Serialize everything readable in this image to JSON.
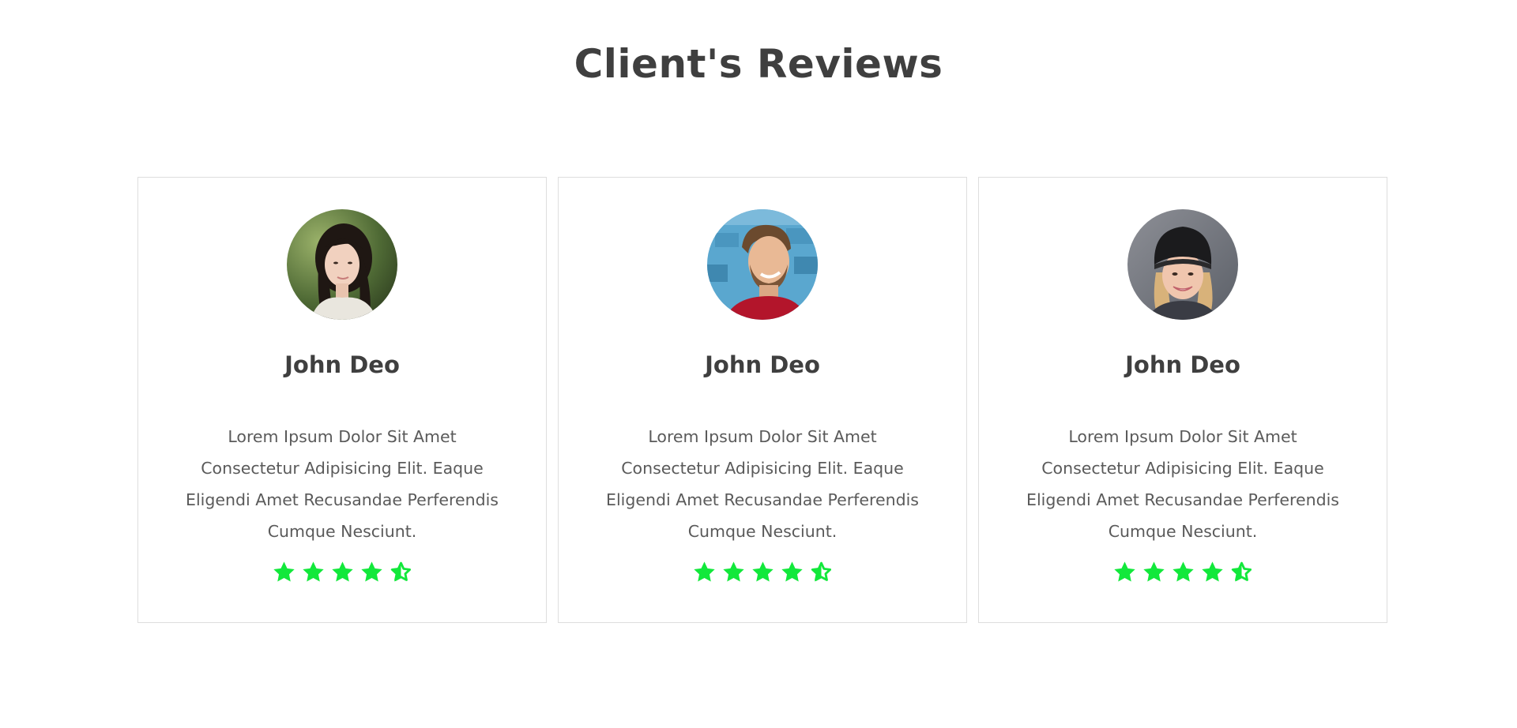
{
  "section": {
    "title": "Client's Reviews"
  },
  "colors": {
    "star": "#12e83b",
    "border": "#dedede",
    "heading": "#3f3f3f"
  },
  "reviews": [
    {
      "name": "John Deo",
      "text": "Lorem Ipsum Dolor Sit Amet Consectetur Adipisicing Elit. Eaque Eligendi Amet Recusandae Perferendis Cumque Nesciunt.",
      "rating": 4.5,
      "avatar": "woman-portrait"
    },
    {
      "name": "John Deo",
      "text": "Lorem Ipsum Dolor Sit Amet Consectetur Adipisicing Elit. Eaque Eligendi Amet Recusandae Perferendis Cumque Nesciunt.",
      "rating": 4.5,
      "avatar": "man-portrait"
    },
    {
      "name": "John Deo",
      "text": "Lorem Ipsum Dolor Sit Amet Consectetur Adipisicing Elit. Eaque Eligendi Amet Recusandae Perferendis Cumque Nesciunt.",
      "rating": 4.5,
      "avatar": "woman-beanie-portrait"
    }
  ]
}
